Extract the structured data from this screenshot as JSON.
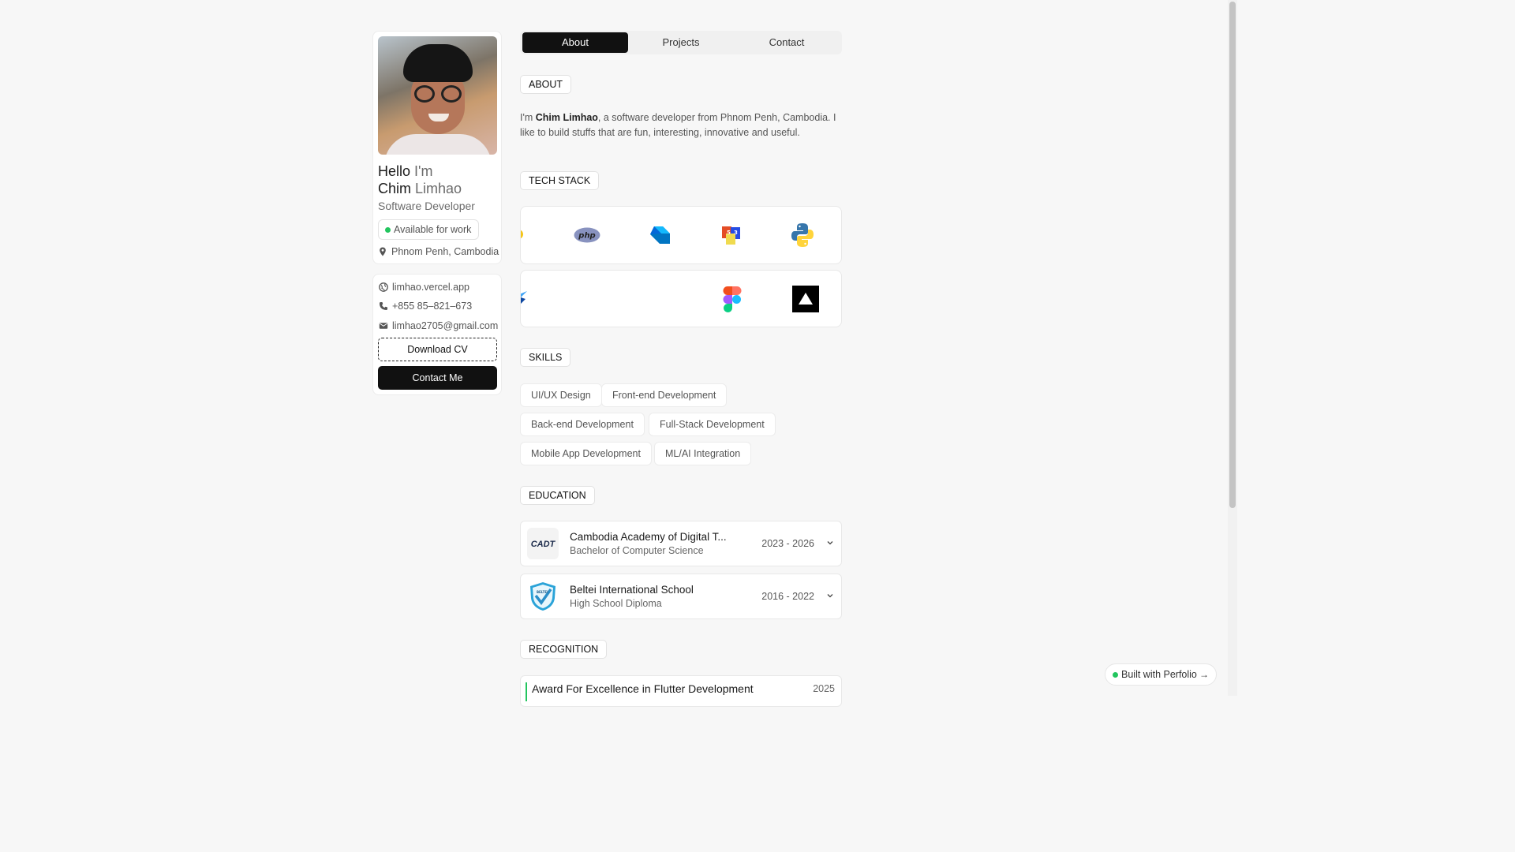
{
  "profile": {
    "hello_first": "Hello",
    "hello_second": "I'm",
    "name_first": "Chim",
    "name_last": "Limhao",
    "role": "Software Developer",
    "availability": "Available for work",
    "location": "Phnom Penh, Cambodia"
  },
  "contact": {
    "website": "limhao.vercel.app",
    "phone": "+855 85–821–673",
    "email": "limhao2705@gmail.com",
    "download_cv": "Download CV",
    "contact_me": "Contact Me"
  },
  "tabs": [
    {
      "label": "About",
      "active": true
    },
    {
      "label": "Projects",
      "active": false
    },
    {
      "label": "Contact",
      "active": false
    }
  ],
  "about": {
    "label": "ABOUT",
    "text_before": "I'm ",
    "text_name": "Chim Limhao",
    "text_after": ", a software developer from Phnom Penh, Cambodia. I like to build stuffs that are fun, interesting, innovative and useful."
  },
  "tech_stack": {
    "label": "TECH STACK",
    "row1": [
      "php-icon",
      "dart-icon",
      "html-css-icon",
      "python-icon"
    ],
    "row2": [
      "flutter-icon",
      "figma-icon",
      "vercel-icon"
    ],
    "php_text": "php"
  },
  "skills": {
    "label": "SKILLS",
    "items": [
      "UI/UX Design",
      "Front-end Development",
      "Back-end Development",
      "Full-Stack Development",
      "Mobile App Development",
      "ML/AI Integration"
    ]
  },
  "education": {
    "label": "EDUCATION",
    "items": [
      {
        "name": "Cambodia Academy of Digital T...",
        "degree": "Bachelor of Computer Science",
        "years": "2023 - 2026",
        "logo_text": "CADT"
      },
      {
        "name": "Beltei International School",
        "degree": "High School Diploma",
        "years": "2016 - 2022",
        "logo_text": "BELTEI"
      }
    ]
  },
  "recognition": {
    "label": "RECOGNITION",
    "items": [
      {
        "title": "Award For Excellence in Flutter Development",
        "year": "2025"
      }
    ]
  },
  "footer_badge": {
    "label": "Built with Perfolio",
    "arrow": "→"
  },
  "colors": {
    "accent_green": "#22c55e",
    "dark": "#111111"
  }
}
